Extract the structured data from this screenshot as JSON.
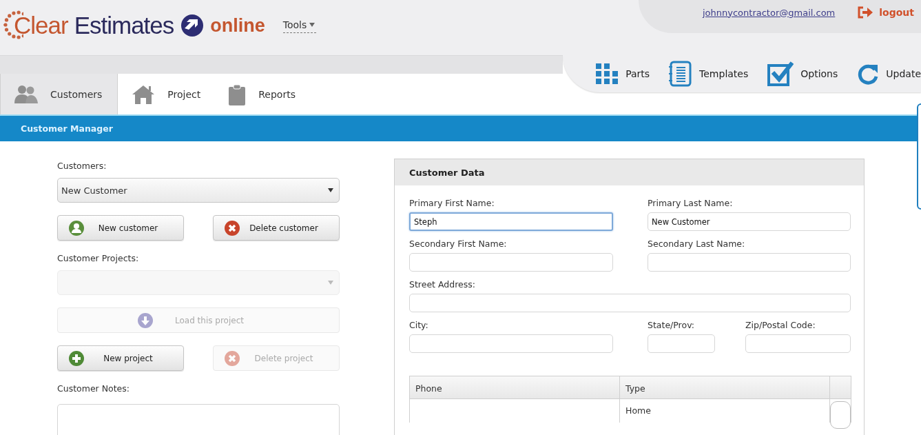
{
  "header": {
    "logo": {
      "first": "Clear",
      "second": "Estimates",
      "third": "online"
    },
    "tools_menu": "Tools"
  },
  "account": {
    "email": "johnnycontractor@gmail.com",
    "logout": "logout"
  },
  "toolbar": [
    {
      "label": "Parts",
      "kind": "grid"
    },
    {
      "label": "Templates",
      "kind": "notebook"
    },
    {
      "label": "Options",
      "kind": "check"
    },
    {
      "label": "Update",
      "kind": "refresh"
    }
  ],
  "tabs": [
    {
      "label": "Customers",
      "kind": "people",
      "selected": true
    },
    {
      "label": "Project",
      "kind": "house",
      "selected": false
    },
    {
      "label": "Reports",
      "kind": "clipboard",
      "selected": false
    }
  ],
  "section_bar": {
    "title": "Customer Manager"
  },
  "customer_manager": [
    {
      "kind": "label",
      "text": "Customers:"
    },
    {
      "kind": "select",
      "value": "New Customer",
      "disabled": false
    },
    {
      "kind": "buttons",
      "buttons": [
        {
          "label": "New customer",
          "kind": "person",
          "disabled": false
        },
        {
          "label": "Delete customer",
          "kind": "cross",
          "disabled": false
        }
      ]
    },
    {
      "kind": "label",
      "text": "Customer Projects:"
    },
    {
      "kind": "select",
      "disabled": true
    },
    {
      "kind": "buttons",
      "buttons": [
        {
          "label": "Load this project",
          "kind": "download",
          "disabled": true
        }
      ]
    },
    {
      "kind": "buttons",
      "buttons": [
        {
          "label": "New project",
          "kind": "plus",
          "disabled": false
        },
        {
          "label": "Delete project",
          "kind": "cross",
          "disabled": true
        }
      ]
    },
    {
      "kind": "label",
      "text": "Customer Notes:"
    },
    {
      "kind": "textarea"
    }
  ],
  "customer_data": {
    "title": "Customer Data",
    "rows": [
      [
        {
          "label": "Primary First Name:",
          "value": "Steph",
          "focused": true
        },
        {
          "label": "Primary Last Name:",
          "value": "New Customer",
          "focused": false
        }
      ],
      [
        {
          "label": "Secondary First Name:",
          "focused": false
        },
        {
          "label": "Secondary Last Name:",
          "focused": false
        }
      ],
      [
        {
          "label": "Street Address:",
          "focused": false
        }
      ],
      [
        {
          "label": "City:",
          "focused": false
        },
        {
          "label": "State/Prov:",
          "focused": false
        },
        {
          "label": "Zip/Postal Code:",
          "focused": false
        }
      ]
    ],
    "phone_table": {
      "columns": [
        "Phone",
        "Type"
      ],
      "rows": [
        {
          "cells": [
            "",
            "Home"
          ]
        }
      ]
    }
  }
}
